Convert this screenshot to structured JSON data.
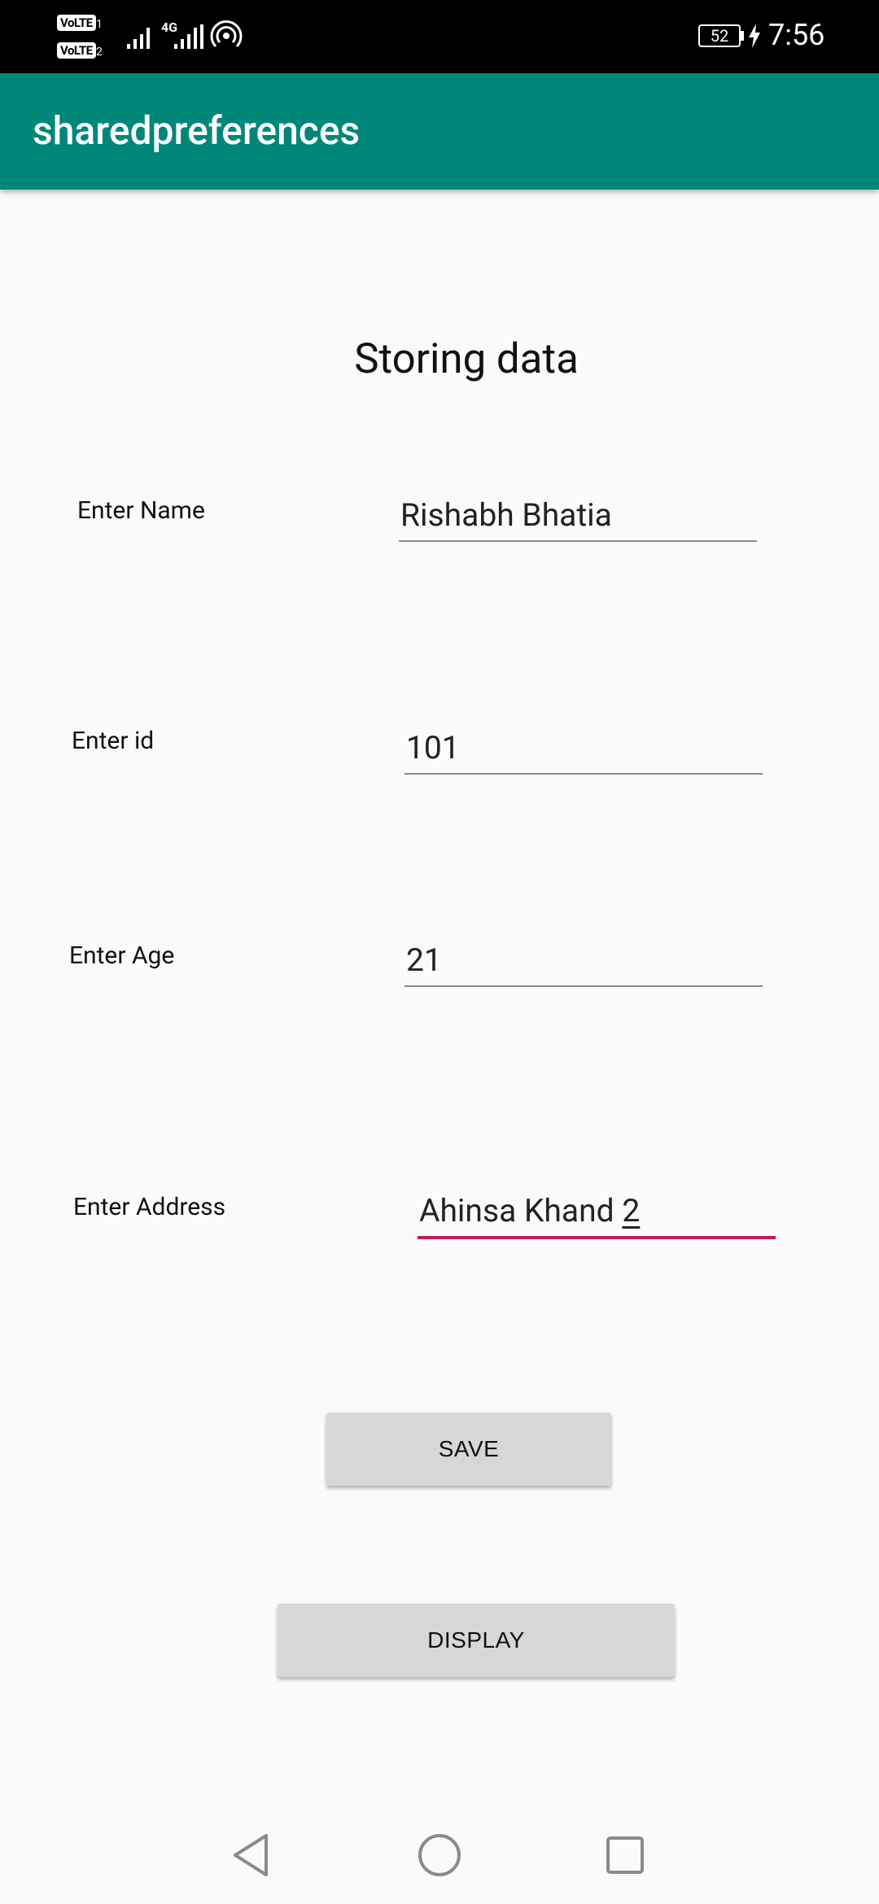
{
  "status_bar": {
    "volte1": "VoLTE",
    "volte1_num": "1",
    "volte2": "VoLTE",
    "volte2_num": "2",
    "network": "4G",
    "battery": "52",
    "time": "7:56"
  },
  "app_bar": {
    "title": "sharedpreferences"
  },
  "main": {
    "heading": "Storing data",
    "fields": [
      {
        "label": "Enter Name",
        "value": "Rishabh Bhatia"
      },
      {
        "label": "Enter id",
        "value": "101"
      },
      {
        "label": "Enter Age",
        "value": "21"
      },
      {
        "label": "Enter Address",
        "value": "Ahinsa Khand ",
        "value_cursor": "2"
      }
    ],
    "buttons": {
      "save": "SAVE",
      "display": "DISPLAY"
    }
  },
  "colors": {
    "app_bar": "#00877a",
    "focus_underline": "#c2185b",
    "button_bg": "#d7d7d7"
  },
  "nav_icons": [
    "back-icon",
    "home-icon",
    "recents-icon"
  ]
}
